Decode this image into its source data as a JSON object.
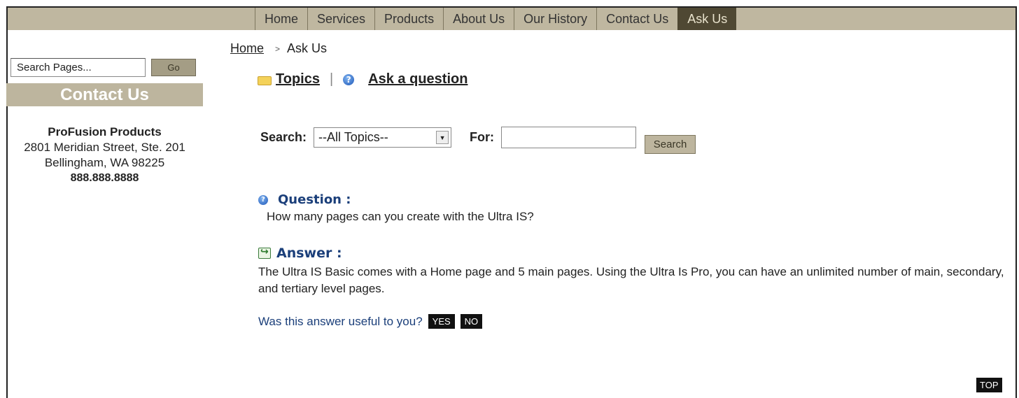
{
  "nav": {
    "items": [
      "Home",
      "Services",
      "Products",
      "About Us",
      "Our History",
      "Contact Us",
      "Ask Us"
    ],
    "active": "Ask Us"
  },
  "sidebar": {
    "search_value": "Search Pages...",
    "go_label": "Go",
    "contact_title": "Contact Us",
    "company": "ProFusion Products",
    "street": "2801 Meridian Street, Ste. 201",
    "city": "Bellingham, WA 98225",
    "phone": "888.888.8888"
  },
  "breadcrumb": {
    "home": "Home",
    "separator": ">",
    "current": "Ask Us"
  },
  "tabs": {
    "topics": "Topics",
    "divider": "|",
    "ask": "Ask a question"
  },
  "search": {
    "label": "Search:",
    "selected_topic": "--All Topics--",
    "for_label": "For:",
    "for_value": "",
    "button": "Search"
  },
  "qa": {
    "question_label": "Question :",
    "question": "How many pages can you create with the Ultra IS?",
    "answer_label": "Answer :",
    "answer": "The Ultra IS Basic comes with a Home page and 5 main pages. Using the Ultra Is Pro, you can have an unlimited number of main, secondary, and tertiary level pages.",
    "useful_prompt": "Was this answer useful to you?",
    "yes": "YES",
    "no": "NO"
  },
  "top_label": "TOP",
  "colors": {
    "nav_bg": "#bfb7a0",
    "nav_active_bg": "#4f4833",
    "accent_blue": "#1b3f7a"
  }
}
